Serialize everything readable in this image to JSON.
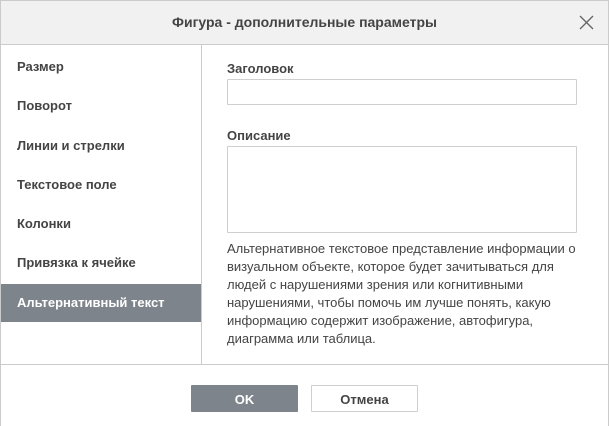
{
  "dialog": {
    "title": "Фигура - дополнительные параметры",
    "close_icon": "close-icon"
  },
  "sidebar": {
    "items": [
      {
        "label": "Размер",
        "active": false
      },
      {
        "label": "Поворот",
        "active": false
      },
      {
        "label": "Линии и стрелки",
        "active": false
      },
      {
        "label": "Текстовое поле",
        "active": false
      },
      {
        "label": "Колонки",
        "active": false
      },
      {
        "label": "Привязка к ячейке",
        "active": false
      },
      {
        "label": "Альтернативный текст",
        "active": true
      }
    ]
  },
  "alt_text": {
    "title_label": "Заголовок",
    "title_value": "",
    "description_label": "Описание",
    "description_value": "",
    "help": "Альтернативное текстовое представление информации о визуальном объекте, которое будет зачитываться для людей с нарушениями зрения или когнитивными нарушениями, чтобы помочь им лучше понять, какую информацию содержит изображение, автофигура, диаграмма или таблица."
  },
  "footer": {
    "ok_label": "OK",
    "cancel_label": "Отмена"
  },
  "colors": {
    "accent": "#7e848b",
    "text": "#444444",
    "border": "#cbcbcb",
    "header_bg": "#f1f1f1"
  }
}
